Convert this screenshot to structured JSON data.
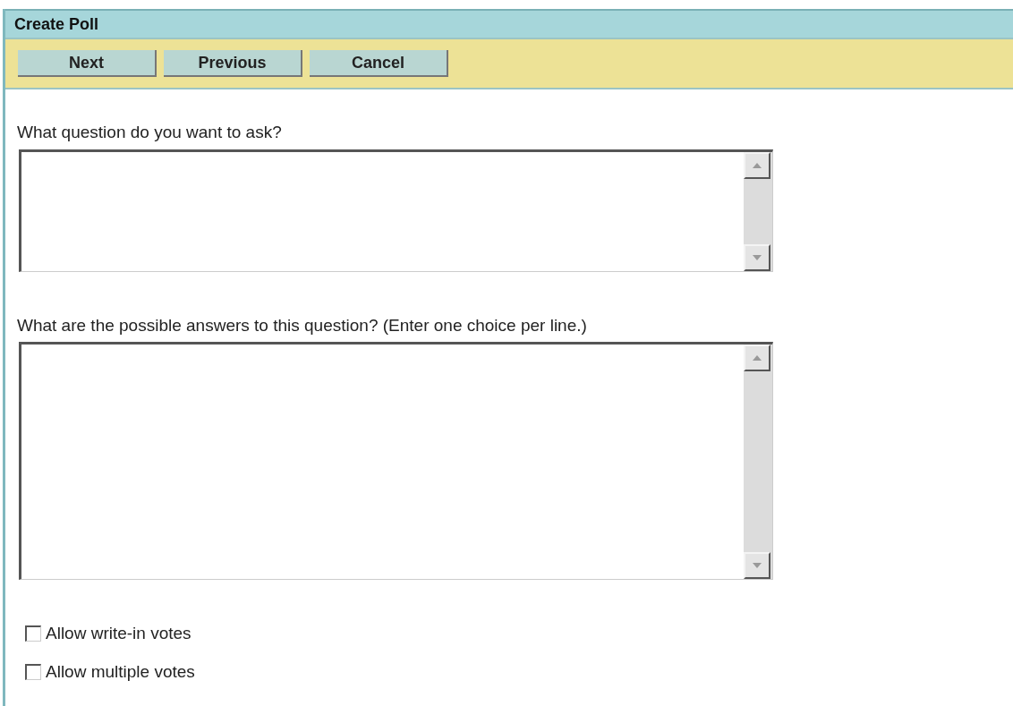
{
  "window": {
    "title": "Create Poll"
  },
  "toolbar": {
    "buttons": [
      "Next",
      "Previous",
      "Cancel"
    ]
  },
  "fields": [
    {
      "label": "What question do you want to ask?",
      "kind": "short"
    },
    {
      "label": "What are the possible answers to this question? (Enter one choice per line.)",
      "kind": "tall"
    }
  ],
  "options": [
    {
      "label": "Allow write-in votes",
      "checked": false
    },
    {
      "label": "Allow multiple votes",
      "checked": false
    }
  ]
}
